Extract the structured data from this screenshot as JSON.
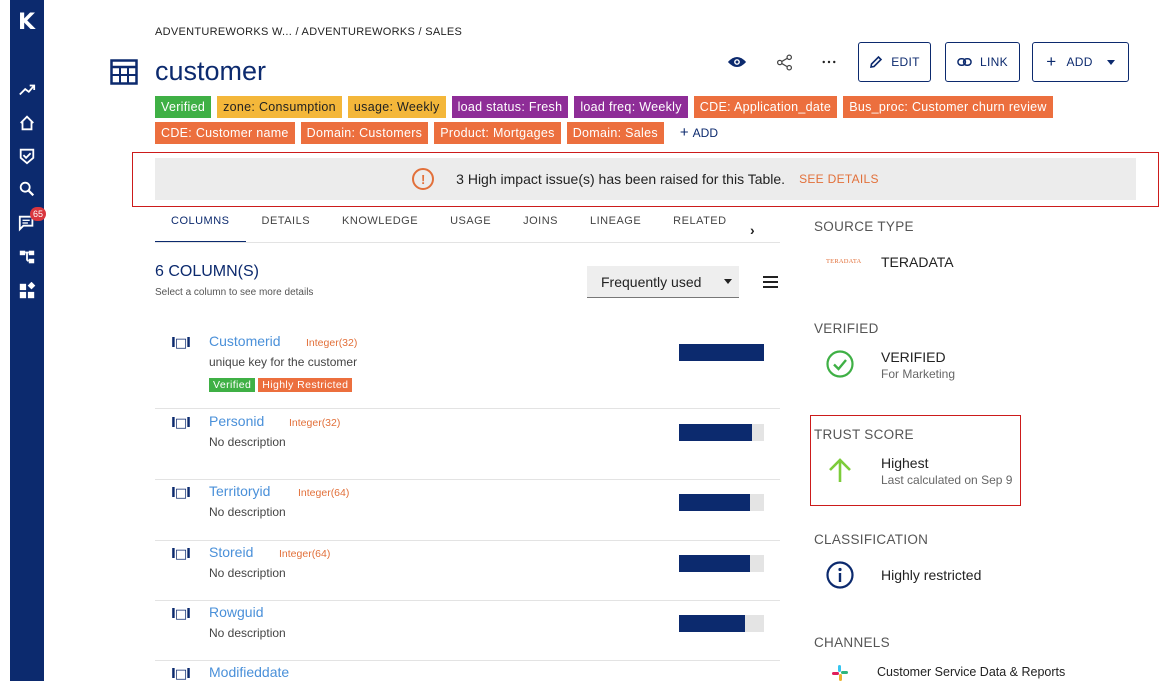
{
  "rail": {
    "logo": "K",
    "items": [
      "trending-icon",
      "home-icon",
      "shield-check-icon",
      "search-icon",
      "chat-icon",
      "lineage-icon",
      "apps-icon"
    ],
    "notification_count": "65"
  },
  "header": {
    "breadcrumb": "ADVENTUREWORKS W... / ADVENTUREWORKS / SALES",
    "title": "customer",
    "edit_label": "EDIT",
    "link_label": "LINK",
    "add_label": "ADD"
  },
  "tags": [
    {
      "label": "Verified",
      "color": "#3fb045",
      "text_color": "#ffffff"
    },
    {
      "label": "zone: Consumption",
      "color": "#f4b73a",
      "text_color": "#222222"
    },
    {
      "label": "usage: Weekly",
      "color": "#f4b73a",
      "text_color": "#222222"
    },
    {
      "label": "load status: Fresh",
      "color": "#8e2d97",
      "text_color": "#ffffff"
    },
    {
      "label": "load freq: Weekly",
      "color": "#8e2d97",
      "text_color": "#ffffff"
    },
    {
      "label": "CDE: Application_date",
      "color": "#ec6f3e",
      "text_color": "#ffffff"
    },
    {
      "label": "Bus_proc: Customer churn review",
      "color": "#ec6f3e",
      "text_color": "#ffffff"
    },
    {
      "label": "CDE: Customer name",
      "color": "#ec6f3e",
      "text_color": "#ffffff"
    },
    {
      "label": "Domain: Customers",
      "color": "#ec6f3e",
      "text_color": "#ffffff"
    },
    {
      "label": "Product: Mortgages",
      "color": "#ec6f3e",
      "text_color": "#ffffff"
    },
    {
      "label": "Domain: Sales",
      "color": "#ec6f3e",
      "text_color": "#ffffff"
    }
  ],
  "add_tag_label": "ADD",
  "alert": {
    "message": "3 High impact issue(s) has been raised for this Table.",
    "action": "SEE DETAILS"
  },
  "tabs": [
    "COLUMNS",
    "DETAILS",
    "KNOWLEDGE",
    "USAGE",
    "JOINS",
    "LINEAGE",
    "RELATED"
  ],
  "columns_panel": {
    "count_label": "6 COLUMN(S)",
    "hint": "Select a column to see more details",
    "sort_selected": "Frequently used"
  },
  "columns": [
    {
      "name": "Customerid",
      "type": "Integer(32)",
      "description": "unique key for the customer",
      "usage": 1.0,
      "tags": [
        {
          "label": "Verified",
          "color": "#3fb045"
        },
        {
          "label": "Highly Restricted",
          "color": "#ec6f3e"
        }
      ]
    },
    {
      "name": "Personid",
      "type": "Integer(32)",
      "description": "No description",
      "usage": 0.86,
      "tags": []
    },
    {
      "name": "Territoryid",
      "type": "Integer(64)",
      "description": "No description",
      "usage": 0.84,
      "tags": []
    },
    {
      "name": "Storeid",
      "type": "Integer(64)",
      "description": "No description",
      "usage": 0.84,
      "tags": []
    },
    {
      "name": "Rowguid",
      "type": "",
      "description": "No description",
      "usage": 0.78,
      "tags": []
    },
    {
      "name": "Modifieddate",
      "type": "",
      "description": "",
      "usage": 0,
      "tags": []
    }
  ],
  "right_panel": {
    "source_type": {
      "label": "SOURCE TYPE",
      "logo_text": "TERADATA",
      "value": "TERADATA"
    },
    "verified": {
      "label": "VERIFIED",
      "value": "VERIFIED",
      "sub": "For Marketing"
    },
    "trust_score": {
      "label": "TRUST SCORE",
      "value": "Highest",
      "sub": "Last calculated on Sep 9"
    },
    "classification": {
      "label": "CLASSIFICATION",
      "value": "Highly restricted"
    },
    "channels": {
      "label": "CHANNELS",
      "value": "Customer Service Data & Reports"
    }
  },
  "colors": {
    "navy": "#0c2a6e",
    "orange": "#e2703a",
    "green": "#3fb045",
    "link_blue": "#4a90d9"
  }
}
